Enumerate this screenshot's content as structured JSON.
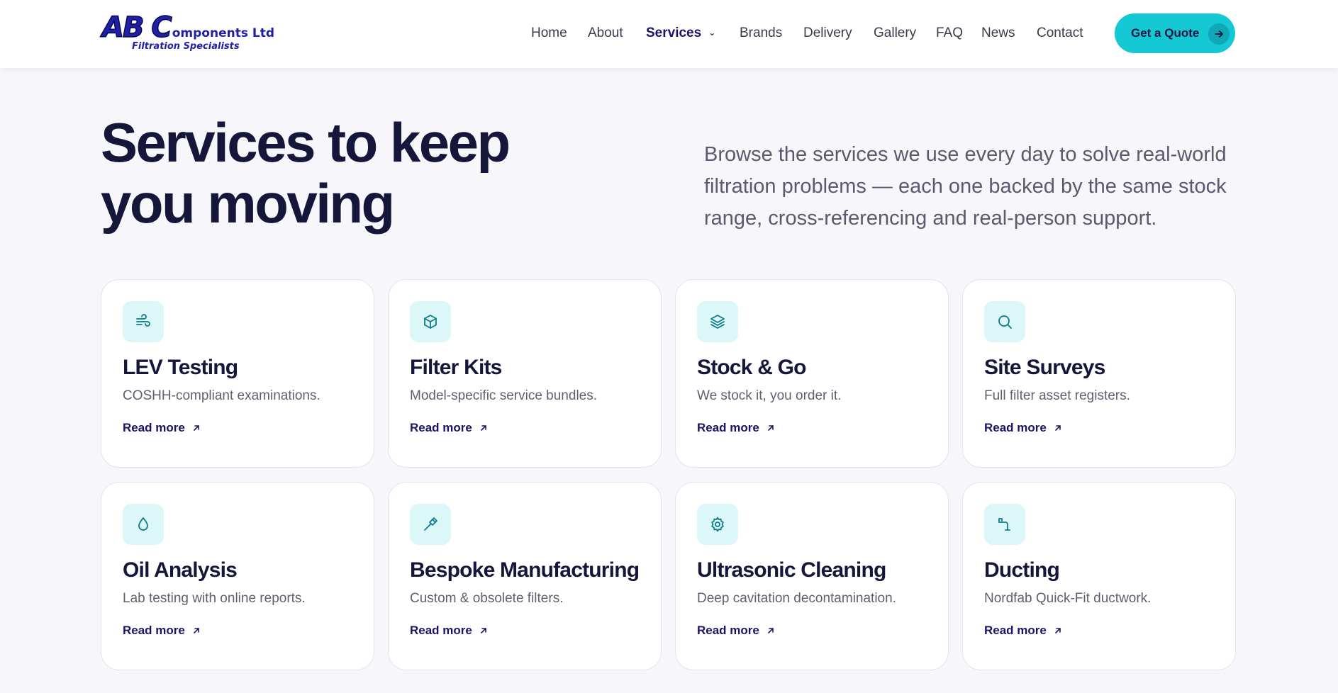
{
  "header": {
    "logo": {
      "line1_big": "AB C",
      "line1_small": "omponents Ltd",
      "line2": "Filtration Specialists"
    },
    "nav": [
      {
        "label": "Home"
      },
      {
        "label": "About"
      },
      {
        "label": "Services",
        "active": true,
        "has_dropdown": true
      },
      {
        "label": "Brands"
      },
      {
        "label": "Delivery"
      },
      {
        "label": "Gallery"
      },
      {
        "label": "FAQ"
      },
      {
        "label": "News"
      },
      {
        "label": "Contact"
      }
    ],
    "cta": {
      "label": "Get a Quote",
      "icon": "arrow-right-icon"
    }
  },
  "hero": {
    "title": "Services to keep you moving",
    "description": "Browse the services we use every day to solve real-world filtration problems — each one backed by the same stock range, cross-referencing and real-person support."
  },
  "cards": [
    {
      "title": "LEV Testing",
      "description": "COSHH-compliant examinations.",
      "link": "Read more",
      "icon": "wind-icon"
    },
    {
      "title": "Filter Kits",
      "description": "Model-specific service bundles.",
      "link": "Read more",
      "icon": "box-icon"
    },
    {
      "title": "Stock & Go",
      "description": "We stock it, you order it.",
      "link": "Read more",
      "icon": "layers-icon"
    },
    {
      "title": "Site Surveys",
      "description": "Full filter asset registers.",
      "link": "Read more",
      "icon": "search-icon"
    },
    {
      "title": "Oil Analysis",
      "description": "Lab testing with online reports.",
      "link": "Read more",
      "icon": "droplet-icon"
    },
    {
      "title": "Bespoke Manufacturing",
      "description": "Custom & obsolete filters.",
      "link": "Read more",
      "icon": "hammer-icon"
    },
    {
      "title": "Ultrasonic Cleaning",
      "description": "Deep cavitation decontamination.",
      "link": "Read more",
      "icon": "gear-icon"
    },
    {
      "title": "Ducting",
      "description": "Nordfab Quick-Fit ductwork.",
      "link": "Read more",
      "icon": "pipe-icon"
    }
  ],
  "colors": {
    "accent": "#14c8d4",
    "brand_navy": "#1a1466",
    "icon_bg": "#dcf7f8",
    "icon_stroke": "#0e7c86",
    "page_bg": "#f7f7fb"
  }
}
